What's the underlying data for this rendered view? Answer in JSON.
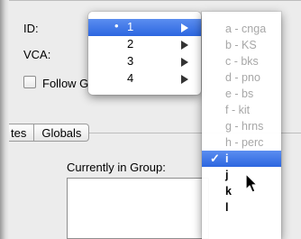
{
  "form": {
    "id_label": "ID:",
    "vca_label": "VCA:",
    "follow_label": "Follow G",
    "currently_in_group_label": "Currently in Group:"
  },
  "tabs": [
    {
      "label": "tes"
    },
    {
      "label": "Globals"
    }
  ],
  "menu_primary": {
    "items": [
      {
        "label": "1",
        "selected": true,
        "has_submenu": true
      },
      {
        "label": "2",
        "has_submenu": true
      },
      {
        "label": "3",
        "has_submenu": true
      },
      {
        "label": "4",
        "has_submenu": true
      }
    ],
    "bullet": "•"
  },
  "menu_sub": {
    "items": [
      {
        "label": "a - cnga",
        "enabled": false
      },
      {
        "label": "b - KS",
        "enabled": false
      },
      {
        "label": "c - bks",
        "enabled": false
      },
      {
        "label": "d - pno",
        "enabled": false
      },
      {
        "label": "e - bs",
        "enabled": false
      },
      {
        "label": "f - kit",
        "enabled": false
      },
      {
        "label": "g - hrns",
        "enabled": false
      },
      {
        "label": "h - perc",
        "enabled": false
      },
      {
        "label": "i",
        "enabled": true,
        "checked": true
      },
      {
        "label": "j",
        "enabled": true
      },
      {
        "label": "k",
        "enabled": true
      },
      {
        "label": "l",
        "enabled": true
      }
    ],
    "checkmark": "✓"
  },
  "colors": {
    "highlight": "#2c66e0",
    "disabled_text": "#a7a7a7",
    "panel": "#ececec"
  },
  "icons": {
    "submenu_arrow": "triangle-right-icon",
    "cursor": "mouse-pointer-icon"
  }
}
